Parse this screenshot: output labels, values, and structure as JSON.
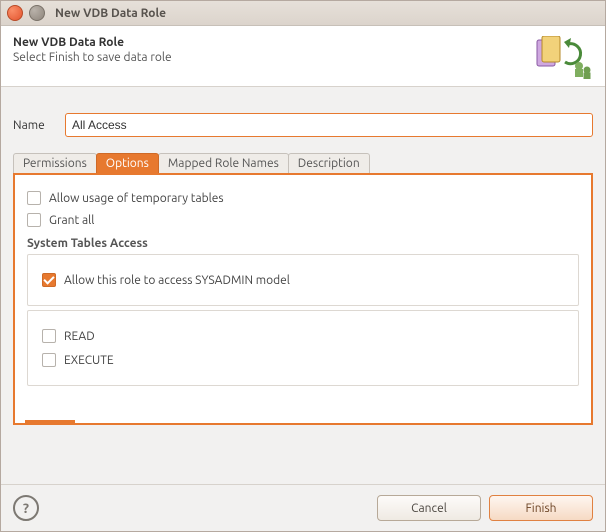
{
  "window": {
    "title": "New VDB Data Role"
  },
  "header": {
    "title": "New VDB Data Role",
    "subtitle": "Select Finish to save data role"
  },
  "name": {
    "label": "Name",
    "value": "All Access"
  },
  "tabs": {
    "permissions": "Permissions",
    "options": "Options",
    "mapped_role_names": "Mapped Role Names",
    "description": "Description"
  },
  "options": {
    "allow_temp_tables": {
      "label": "Allow usage of temporary tables",
      "checked": false
    },
    "grant_all": {
      "label": "Grant all",
      "checked": false
    },
    "system_group_title": "System Tables Access",
    "allow_sysadmin": {
      "label": "Allow this role to access SYSADMIN model",
      "checked": true
    },
    "read": {
      "label": "READ",
      "checked": false
    },
    "execute": {
      "label": "EXECUTE",
      "checked": false
    }
  },
  "footer": {
    "help": "?",
    "cancel": "Cancel",
    "finish": "Finish"
  }
}
